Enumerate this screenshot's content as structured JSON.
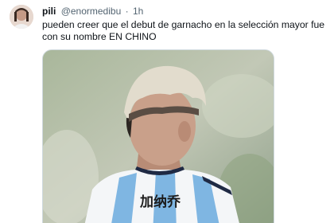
{
  "tweet": {
    "author": {
      "display_name": "pili",
      "handle": "@enormedibu",
      "avatar_icon": "profile-avatar"
    },
    "separator": "·",
    "time": "1h",
    "text": "pueden creer que el debut de garnacho en la selección mayor fue con su nombre EN CHINO",
    "media": {
      "jersey_text": "加纳乔",
      "colors": {
        "jersey_blue": "#7fb6e2",
        "jersey_white": "#f4f6f8",
        "hair": "#d8d2c4",
        "skin": "#c9a08a",
        "background": "#b7c2ac"
      }
    }
  },
  "theme": {
    "text_primary": "#0f1419",
    "text_secondary": "#536471",
    "border": "#cfd9de"
  }
}
